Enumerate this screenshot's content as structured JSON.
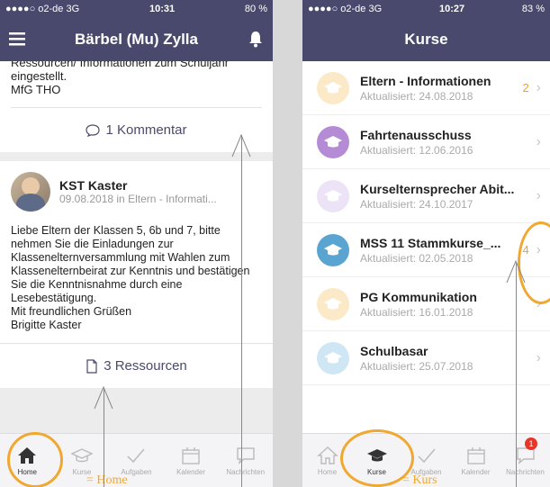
{
  "left": {
    "status": {
      "carrier": "●●●●○ o2-de  3G",
      "time": "10:31",
      "battery": "80 %"
    },
    "header": {
      "title": "Bärbel (Mu) Zylla"
    },
    "card1": {
      "lines": [
        "Ressourcen/ Informationen zum Schuljahr",
        "eingestellt.",
        "MfG THO"
      ],
      "comment_label": "1 Kommentar"
    },
    "card2": {
      "author": "KST Kaster",
      "meta": "09.08.2018 in Eltern - Informati...",
      "body": "Liebe Eltern der Klassen 5, 6b und 7, bitte nehmen Sie die Einladungen zur Klassenelternversammlung mit Wahlen zum Klassenelternbeirat zur Kenntnis und bestätigen Sie die Kenntnisnahme durch eine Lesebestätigung.",
      "greeting": "Mit freundlichen Grüßen",
      "signature": "Brigitte Kaster",
      "resources_label": "3 Ressourcen"
    },
    "tabs": [
      {
        "label": "Home",
        "icon": "home-icon",
        "active": true
      },
      {
        "label": "Kurse",
        "icon": "graduation-cap-icon",
        "active": false
      },
      {
        "label": "Aufgaben",
        "icon": "checkmark-icon",
        "active": false
      },
      {
        "label": "Kalender",
        "icon": "calendar-icon",
        "active": false
      },
      {
        "label": "Nachrichten",
        "icon": "chat-bubble-icon",
        "active": false
      }
    ],
    "annotation": "= Home"
  },
  "right": {
    "status": {
      "carrier": "●●●●○ o2-de  3G",
      "time": "10:27",
      "battery": "83 %"
    },
    "header": {
      "title": "Kurse"
    },
    "courses": [
      {
        "title": "Eltern - Informationen",
        "updated": "Aktualisiert: 24.08.2018",
        "count": "2",
        "color": "#fbe9c8"
      },
      {
        "title": "Fahrtenausschuss",
        "updated": "Aktualisiert: 12.06.2016",
        "count": "",
        "color": "#b58bd6"
      },
      {
        "title": "Kurselternsprecher Abit...",
        "updated": "Aktualisiert: 24.10.2017",
        "count": "",
        "color": "#ede3f6"
      },
      {
        "title": "MSS 11 Stammkurse_...",
        "updated": "Aktualisiert: 02.05.2018",
        "count": "4",
        "color": "#5aa4d2"
      },
      {
        "title": "PG Kommunikation",
        "updated": "Aktualisiert: 16.01.2018",
        "count": "",
        "color": "#fbe9c8"
      },
      {
        "title": "Schulbasar",
        "updated": "Aktualisiert: 25.07.2018",
        "count": "",
        "color": "#cfe6f5"
      }
    ],
    "tabs": [
      {
        "label": "Home",
        "icon": "home-icon",
        "active": false
      },
      {
        "label": "Kurse",
        "icon": "graduation-cap-icon",
        "active": true
      },
      {
        "label": "Aufgaben",
        "icon": "checkmark-icon",
        "active": false
      },
      {
        "label": "Kalender",
        "icon": "calendar-icon",
        "active": false
      },
      {
        "label": "Nachrichten",
        "icon": "chat-bubble-icon",
        "active": false,
        "badge": "1"
      }
    ],
    "annotation": "= Kurs"
  },
  "colors": {
    "header": "#49496d",
    "accent": "#f0a830",
    "badge": "#e8352a"
  }
}
